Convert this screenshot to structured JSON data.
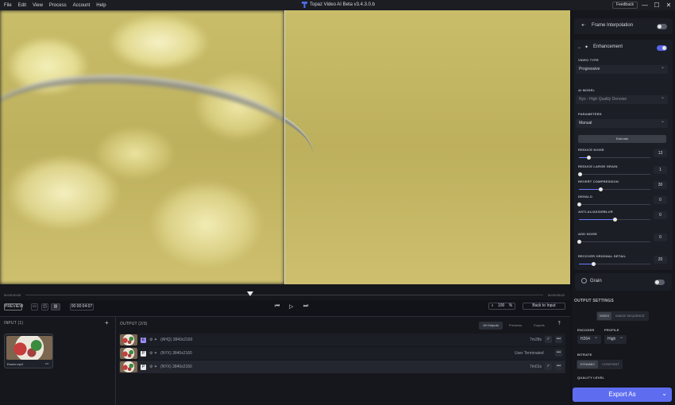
{
  "menu": [
    "File",
    "Edit",
    "View",
    "Process",
    "Account",
    "Help"
  ],
  "app": {
    "title": "Topaz Video AI Beta  v3.4.3.0.b"
  },
  "feedback": "Feedback",
  "window": {
    "minimize": "—",
    "maximize": "☐",
    "close": "✕"
  },
  "timeline": {
    "start": "00:00:00:00",
    "end": "00:00:08:22"
  },
  "controls": {
    "preview": "PREVIEW",
    "time": "00:00:04:07",
    "zoom": "100",
    "zoom_unit": "%",
    "back_to_input": "Back to Input"
  },
  "input": {
    "header": "INPUT (1)",
    "add": "+",
    "file": "Essen.mp4",
    "menu": "•••"
  },
  "output": {
    "header": "OUTPUT (2/3)",
    "tabs": [
      "All Outputs",
      "Previews",
      "Exports"
    ],
    "upload_icon": "⤒",
    "rows": [
      {
        "tag": "E",
        "tag_color": "#9b8cf5",
        "model": "(AHQ)  3840x2160",
        "status": "7m28s",
        "check": "✓",
        "more": "•••"
      },
      {
        "tag": "P",
        "tag_color": "#e8e8e8",
        "model": "(NYX)  3840x2160",
        "status": "User Terminated",
        "check": "",
        "more": "•••"
      },
      {
        "tag": "P",
        "tag_color": "#e8e8e8",
        "model": "(NYX)  3840x2160",
        "status": "7m01s",
        "check": "✓",
        "more": "•••"
      }
    ]
  },
  "sidebar": {
    "frame_interpolation": "Frame Interpolation",
    "enhancement": "Enhancement",
    "video_type_label": "VIDEO TYPE",
    "video_type": "Progressive",
    "ai_model_label": "AI MODEL",
    "ai_model": "Nyx - High Quality Denoise",
    "parameters_label": "PARAMETERS",
    "parameters": "Manual",
    "estimate": "Estimate",
    "sliders": [
      {
        "label": "REDUCE NOISE",
        "value": "13",
        "fraction": 0.13
      },
      {
        "label": "REDUCE LARGE GRAIN",
        "value": "1",
        "fraction": 0.01
      },
      {
        "label": "REVERT COMPRESSION",
        "value": "30",
        "fraction": 0.3
      },
      {
        "label": "DEHALO",
        "value": "0",
        "fraction": 0
      },
      {
        "label": "ANTI-ALIAS/DEBLUR",
        "value": "0",
        "fraction": 0.5
      },
      {
        "label": "ADD NOISE",
        "value": "0",
        "fraction": 0
      },
      {
        "label": "RECOVER ORIGINAL DETAIL",
        "value": "20",
        "fraction": 0.2
      }
    ],
    "grain": "Grain",
    "output_settings": "OUTPUT SETTINGS",
    "video_btn": "VIDEO",
    "image_seq_btn": "IMAGE SEQUENCE",
    "encoder_label": "ENCODER",
    "encoder": "H264",
    "profile_label": "PROFILE",
    "profile": "High",
    "bitrate_label": "BITRATE",
    "dynamic": "DYNAMIC",
    "constant": "CONSTANT",
    "quality_label": "QUALITY LEVEL",
    "export": "Export As",
    "export_arrow": "⌄"
  }
}
